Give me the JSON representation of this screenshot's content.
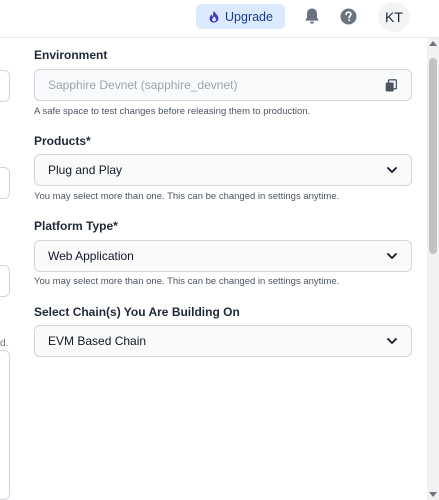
{
  "header": {
    "upgrade_label": "Upgrade",
    "avatar_initials": "KT",
    "accent_color": "#dbeafe"
  },
  "left_panel": {
    "truncated_text": "d."
  },
  "form": {
    "environment": {
      "label": "Environment",
      "value": "Sapphire Devnet (sapphire_devnet)",
      "help": "A safe space to test changes before releasing them to production."
    },
    "products": {
      "label": "Products*",
      "value": "Plug and Play",
      "help": "You may select more than one. This can be changed in settings anytime."
    },
    "platform_type": {
      "label": "Platform Type*",
      "value": "Web Application",
      "help": "You may select more than one. This can be changed in settings anytime."
    },
    "chains": {
      "label": "Select Chain(s) You Are Building On",
      "value": "EVM Based Chain"
    }
  }
}
